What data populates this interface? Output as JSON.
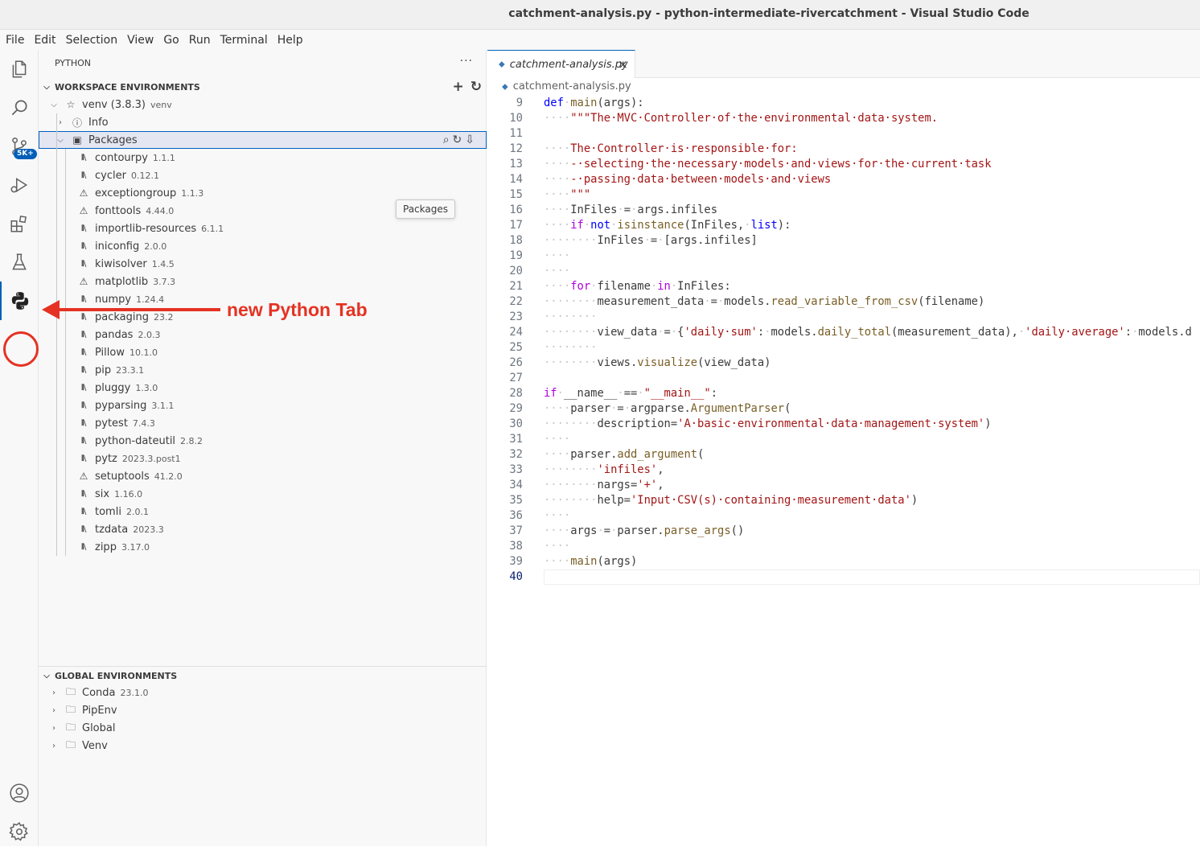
{
  "window": {
    "title": "catchment-analysis.py - python-intermediate-rivercatchment - Visual Studio Code"
  },
  "menu": [
    "File",
    "Edit",
    "Selection",
    "View",
    "Go",
    "Run",
    "Terminal",
    "Help"
  ],
  "activity_bar": {
    "icons": [
      "explorer-icon",
      "search-icon",
      "source-control-icon",
      "run-debug-icon",
      "extensions-icon",
      "testing-icon",
      "python-icon",
      "account-icon",
      "settings-gear-icon"
    ],
    "source_control_badge": "5K+",
    "active": "python-icon"
  },
  "annotation": {
    "text": "new Python Tab",
    "color": "#e53222"
  },
  "sidebar": {
    "title": "PYTHON",
    "workspace_header": "WORKSPACE ENVIRONMENTS",
    "venv": {
      "name": "venv (3.8.3)",
      "desc": "venv"
    },
    "info_label": "Info",
    "packages_label": "Packages",
    "tooltip": "Packages",
    "packages": [
      {
        "name": "contourpy",
        "version": "1.1.1",
        "icon": "library-icon"
      },
      {
        "name": "cycler",
        "version": "0.12.1",
        "icon": "library-icon"
      },
      {
        "name": "exceptiongroup",
        "version": "1.1.3",
        "icon": "warning-icon"
      },
      {
        "name": "fonttools",
        "version": "4.44.0",
        "icon": "warning-icon"
      },
      {
        "name": "importlib-resources",
        "version": "6.1.1",
        "icon": "library-icon"
      },
      {
        "name": "iniconfig",
        "version": "2.0.0",
        "icon": "library-icon"
      },
      {
        "name": "kiwisolver",
        "version": "1.4.5",
        "icon": "library-icon"
      },
      {
        "name": "matplotlib",
        "version": "3.7.3",
        "icon": "warning-icon"
      },
      {
        "name": "numpy",
        "version": "1.24.4",
        "icon": "library-icon"
      },
      {
        "name": "packaging",
        "version": "23.2",
        "icon": "library-icon"
      },
      {
        "name": "pandas",
        "version": "2.0.3",
        "icon": "library-icon"
      },
      {
        "name": "Pillow",
        "version": "10.1.0",
        "icon": "library-icon"
      },
      {
        "name": "pip",
        "version": "23.3.1",
        "icon": "library-icon"
      },
      {
        "name": "pluggy",
        "version": "1.3.0",
        "icon": "library-icon"
      },
      {
        "name": "pyparsing",
        "version": "3.1.1",
        "icon": "library-icon"
      },
      {
        "name": "pytest",
        "version": "7.4.3",
        "icon": "library-icon"
      },
      {
        "name": "python-dateutil",
        "version": "2.8.2",
        "icon": "library-icon"
      },
      {
        "name": "pytz",
        "version": "2023.3.post1",
        "icon": "library-icon"
      },
      {
        "name": "setuptools",
        "version": "41.2.0",
        "icon": "warning-icon"
      },
      {
        "name": "six",
        "version": "1.16.0",
        "icon": "library-icon"
      },
      {
        "name": "tomli",
        "version": "2.0.1",
        "icon": "library-icon"
      },
      {
        "name": "tzdata",
        "version": "2023.3",
        "icon": "library-icon"
      },
      {
        "name": "zipp",
        "version": "3.17.0",
        "icon": "library-icon"
      }
    ],
    "global_header": "GLOBAL ENVIRONMENTS",
    "global_envs": [
      {
        "name": "Conda",
        "version": "23.1.0"
      },
      {
        "name": "PipEnv",
        "version": ""
      },
      {
        "name": "Global",
        "version": ""
      },
      {
        "name": "Venv",
        "version": ""
      }
    ]
  },
  "editor": {
    "tab_label": "catchment-analysis.py",
    "breadcrumb": "catchment-analysis.py",
    "current_line": 40,
    "lines": [
      {
        "n": "9",
        "parts": [
          [
            "kw",
            "def"
          ],
          [
            "ws",
            "·"
          ],
          [
            "fn",
            "main"
          ],
          [
            "nm",
            "(args):"
          ]
        ]
      },
      {
        "n": "10",
        "parts": [
          [
            "ws",
            "····"
          ],
          [
            "str",
            "\"\"\"The·MVC·Controller·of·the·environmental·data·system."
          ]
        ]
      },
      {
        "n": "11",
        "parts": []
      },
      {
        "n": "12",
        "parts": [
          [
            "ws",
            "····"
          ],
          [
            "str",
            "The·Controller·is·responsible·for:"
          ]
        ]
      },
      {
        "n": "13",
        "parts": [
          [
            "ws",
            "····"
          ],
          [
            "str",
            "-·selecting·the·necessary·models·and·views·for·the·current·task"
          ]
        ]
      },
      {
        "n": "14",
        "parts": [
          [
            "ws",
            "····"
          ],
          [
            "str",
            "-·passing·data·between·models·and·views"
          ]
        ]
      },
      {
        "n": "15",
        "parts": [
          [
            "ws",
            "····"
          ],
          [
            "str",
            "\"\"\""
          ]
        ]
      },
      {
        "n": "16",
        "parts": [
          [
            "ws",
            "····"
          ],
          [
            "nm",
            "InFiles"
          ],
          [
            "ws",
            "·"
          ],
          [
            "nm",
            "="
          ],
          [
            "ws",
            "·"
          ],
          [
            "nm",
            "args.infiles"
          ]
        ]
      },
      {
        "n": "17",
        "parts": [
          [
            "ws",
            "····"
          ],
          [
            "kw2",
            "if"
          ],
          [
            "ws",
            "·"
          ],
          [
            "kw",
            "not"
          ],
          [
            "ws",
            "·"
          ],
          [
            "fn",
            "isinstance"
          ],
          [
            "nm",
            "(InFiles,"
          ],
          [
            "ws",
            "·"
          ],
          [
            "kw",
            "list"
          ],
          [
            "nm",
            "):"
          ]
        ]
      },
      {
        "n": "18",
        "parts": [
          [
            "ws",
            "········"
          ],
          [
            "nm",
            "InFiles"
          ],
          [
            "ws",
            "·"
          ],
          [
            "nm",
            "="
          ],
          [
            "ws",
            "·"
          ],
          [
            "nm",
            "[args.infiles]"
          ]
        ]
      },
      {
        "n": "19",
        "parts": [
          [
            "ws",
            "····"
          ]
        ]
      },
      {
        "n": "20",
        "parts": [
          [
            "ws",
            "····"
          ]
        ]
      },
      {
        "n": "21",
        "parts": [
          [
            "ws",
            "····"
          ],
          [
            "kw2",
            "for"
          ],
          [
            "ws",
            "·"
          ],
          [
            "nm",
            "filename"
          ],
          [
            "ws",
            "·"
          ],
          [
            "kw2",
            "in"
          ],
          [
            "ws",
            "·"
          ],
          [
            "nm",
            "InFiles:"
          ]
        ]
      },
      {
        "n": "22",
        "parts": [
          [
            "ws",
            "········"
          ],
          [
            "nm",
            "measurement_data"
          ],
          [
            "ws",
            "·"
          ],
          [
            "nm",
            "="
          ],
          [
            "ws",
            "·"
          ],
          [
            "nm",
            "models."
          ],
          [
            "fn",
            "read_variable_from_csv"
          ],
          [
            "nm",
            "(filename)"
          ]
        ]
      },
      {
        "n": "23",
        "parts": [
          [
            "ws",
            "········"
          ]
        ]
      },
      {
        "n": "24",
        "parts": [
          [
            "ws",
            "········"
          ],
          [
            "nm",
            "view_data"
          ],
          [
            "ws",
            "·"
          ],
          [
            "nm",
            "="
          ],
          [
            "ws",
            "·"
          ],
          [
            "nm",
            "{"
          ],
          [
            "str",
            "'daily·sum'"
          ],
          [
            "nm",
            ":"
          ],
          [
            "ws",
            "·"
          ],
          [
            "nm",
            "models."
          ],
          [
            "fn",
            "daily_total"
          ],
          [
            "nm",
            "(measurement_data),"
          ],
          [
            "ws",
            "·"
          ],
          [
            "str",
            "'daily·average'"
          ],
          [
            "nm",
            ":"
          ],
          [
            "ws",
            "·"
          ],
          [
            "nm",
            "models.d"
          ]
        ]
      },
      {
        "n": "25",
        "parts": [
          [
            "ws",
            "········"
          ]
        ]
      },
      {
        "n": "26",
        "parts": [
          [
            "ws",
            "········"
          ],
          [
            "nm",
            "views."
          ],
          [
            "fn",
            "visualize"
          ],
          [
            "nm",
            "(view_data)"
          ]
        ]
      },
      {
        "n": "27",
        "parts": []
      },
      {
        "n": "28",
        "parts": [
          [
            "kw2",
            "if"
          ],
          [
            "ws",
            "·"
          ],
          [
            "nm",
            "__name__"
          ],
          [
            "ws",
            "·"
          ],
          [
            "nm",
            "=="
          ],
          [
            "ws",
            "·"
          ],
          [
            "str",
            "\"__main__\""
          ],
          [
            "nm",
            ":"
          ]
        ]
      },
      {
        "n": "29",
        "parts": [
          [
            "ws",
            "····"
          ],
          [
            "nm",
            "parser"
          ],
          [
            "ws",
            "·"
          ],
          [
            "nm",
            "="
          ],
          [
            "ws",
            "·"
          ],
          [
            "nm",
            "argparse."
          ],
          [
            "fn",
            "ArgumentParser"
          ],
          [
            "nm",
            "("
          ]
        ]
      },
      {
        "n": "30",
        "parts": [
          [
            "ws",
            "········"
          ],
          [
            "nm",
            "description="
          ],
          [
            "str",
            "'A·basic·environmental·data·management·system'"
          ],
          [
            "nm",
            ")"
          ]
        ]
      },
      {
        "n": "31",
        "parts": [
          [
            "ws",
            "····"
          ]
        ]
      },
      {
        "n": "32",
        "parts": [
          [
            "ws",
            "····"
          ],
          [
            "nm",
            "parser."
          ],
          [
            "fn",
            "add_argument"
          ],
          [
            "nm",
            "("
          ]
        ]
      },
      {
        "n": "33",
        "parts": [
          [
            "ws",
            "········"
          ],
          [
            "str",
            "'infiles'"
          ],
          [
            "nm",
            ","
          ]
        ]
      },
      {
        "n": "34",
        "parts": [
          [
            "ws",
            "········"
          ],
          [
            "nm",
            "nargs="
          ],
          [
            "str",
            "'+'"
          ],
          [
            "nm",
            ","
          ]
        ]
      },
      {
        "n": "35",
        "parts": [
          [
            "ws",
            "········"
          ],
          [
            "nm",
            "help="
          ],
          [
            "str",
            "'Input·CSV(s)·containing·measurement·data'"
          ],
          [
            "nm",
            ")"
          ]
        ]
      },
      {
        "n": "36",
        "parts": [
          [
            "ws",
            "····"
          ]
        ]
      },
      {
        "n": "37",
        "parts": [
          [
            "ws",
            "····"
          ],
          [
            "nm",
            "args"
          ],
          [
            "ws",
            "·"
          ],
          [
            "nm",
            "="
          ],
          [
            "ws",
            "·"
          ],
          [
            "nm",
            "parser."
          ],
          [
            "fn",
            "parse_args"
          ],
          [
            "nm",
            "()"
          ]
        ]
      },
      {
        "n": "38",
        "parts": [
          [
            "ws",
            "····"
          ]
        ]
      },
      {
        "n": "39",
        "parts": [
          [
            "ws",
            "····"
          ],
          [
            "fn",
            "main"
          ],
          [
            "nm",
            "(args)"
          ]
        ]
      },
      {
        "n": "40",
        "parts": []
      }
    ]
  }
}
